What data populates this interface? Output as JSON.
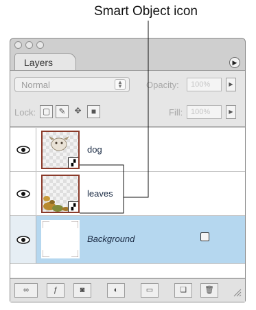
{
  "callout": {
    "text": "Smart Object icon"
  },
  "panel": {
    "tab_label": "Layers",
    "blend_mode": "Normal",
    "opacity_label": "Opacity:",
    "opacity_value": "100%",
    "lock_label": "Lock:",
    "fill_label": "Fill:",
    "fill_value": "100%"
  },
  "layers": [
    {
      "name": "dog",
      "smart_object": true,
      "selected": false
    },
    {
      "name": "leaves",
      "smart_object": true,
      "selected": false
    },
    {
      "name": "Background",
      "smart_object": false,
      "selected": true,
      "locked": true
    }
  ],
  "colors": {
    "selected_row": "#b5d7ef",
    "panel": "#cfcfcf",
    "thumb_border": "#8a3a2a"
  }
}
